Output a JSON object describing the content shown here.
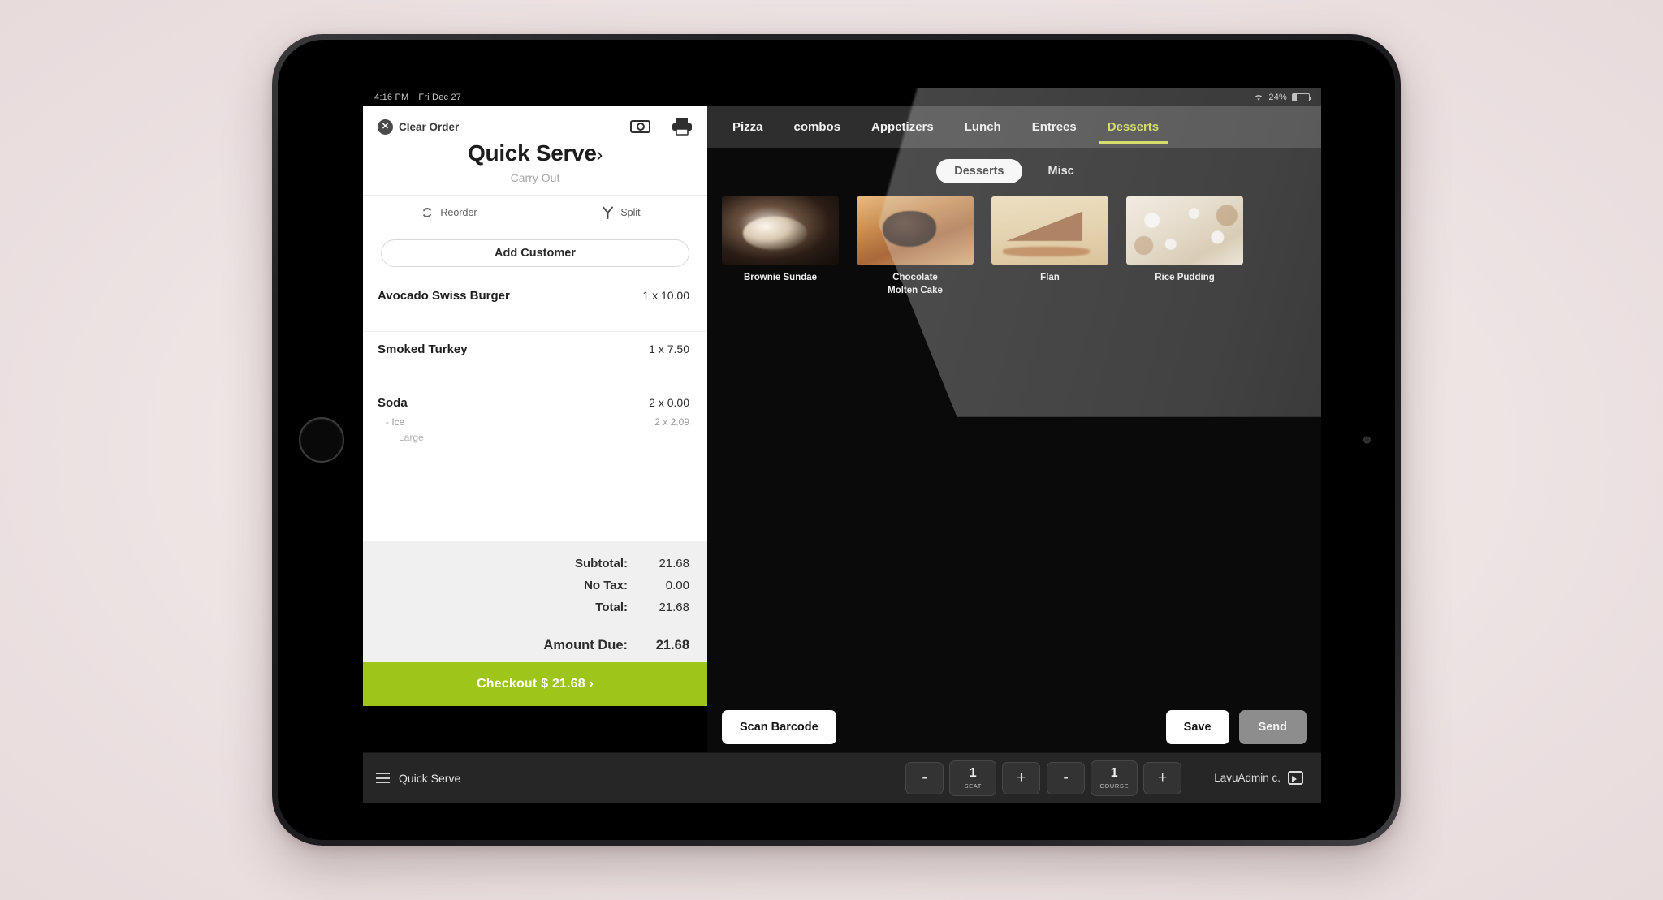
{
  "status_bar": {
    "time": "4:16 PM",
    "date": "Fri Dec 27",
    "battery_percent": "24%",
    "wifi_icon": "wifi-icon",
    "battery_icon": "battery-icon"
  },
  "order_panel": {
    "clear_order_label": "Clear Order",
    "clear_order_icon": "close-circle-icon",
    "cash_icon": "cash-bill-icon",
    "print_icon": "printer-icon",
    "store_title": "Quick Serve",
    "store_title_chevron": "›",
    "order_type": "Carry Out",
    "reorder_label": "Reorder",
    "reorder_icon": "refresh-icon",
    "split_label": "Split",
    "split_icon": "split-branch-icon",
    "add_customer_label": "Add Customer",
    "items": [
      {
        "name": "Avocado Swiss Burger",
        "price": "1 x 10.00",
        "modifiers": []
      },
      {
        "name": "Smoked Turkey",
        "price": "1 x 7.50",
        "modifiers": []
      },
      {
        "name": "Soda",
        "price": "2 x 0.00",
        "modifiers": [
          {
            "name": "- Ice",
            "price": "2 x 2.09"
          },
          {
            "name": "Large",
            "price": ""
          }
        ]
      }
    ],
    "totals": [
      {
        "label": "Subtotal:",
        "value": "21.68"
      },
      {
        "label": "No Tax:",
        "value": "0.00"
      },
      {
        "label": "Total:",
        "value": "21.68"
      }
    ],
    "amount_due_label": "Amount Due:",
    "amount_due_value": "21.68",
    "checkout_label": "Checkout $ 21.68  ›",
    "checkout_color": "#9ec51a"
  },
  "menu": {
    "category_tabs": [
      {
        "label": "Pizza",
        "active": false
      },
      {
        "label": "combos",
        "active": false
      },
      {
        "label": "Appetizers",
        "active": false
      },
      {
        "label": "Lunch",
        "active": false
      },
      {
        "label": "Entrees",
        "active": false
      },
      {
        "label": "Desserts",
        "active": true
      }
    ],
    "active_tab_color": "#cfdd3a",
    "subcategories": [
      {
        "label": "Desserts",
        "active": true
      },
      {
        "label": "Misc",
        "active": false
      }
    ],
    "products": [
      {
        "name": "Brownie Sundae",
        "art": "img-brownie"
      },
      {
        "name": "Chocolate\nMolten Cake",
        "art": "img-molten"
      },
      {
        "name": "Flan",
        "art": "img-flan"
      },
      {
        "name": "Rice Pudding",
        "art": "img-rice"
      }
    ],
    "actions": {
      "scan_barcode_label": "Scan Barcode",
      "save_label": "Save",
      "send_label": "Send"
    }
  },
  "bottom_bar": {
    "menu_icon": "hamburger-menu-icon",
    "order_mode": "Quick Serve",
    "seat": {
      "minus": "-",
      "value": "1",
      "unit": "SEAT",
      "plus": "+"
    },
    "course": {
      "minus": "-",
      "value": "1",
      "unit": "COURSE",
      "plus": "+"
    },
    "user": "LavuAdmin c.",
    "logout_icon": "logout-icon"
  }
}
